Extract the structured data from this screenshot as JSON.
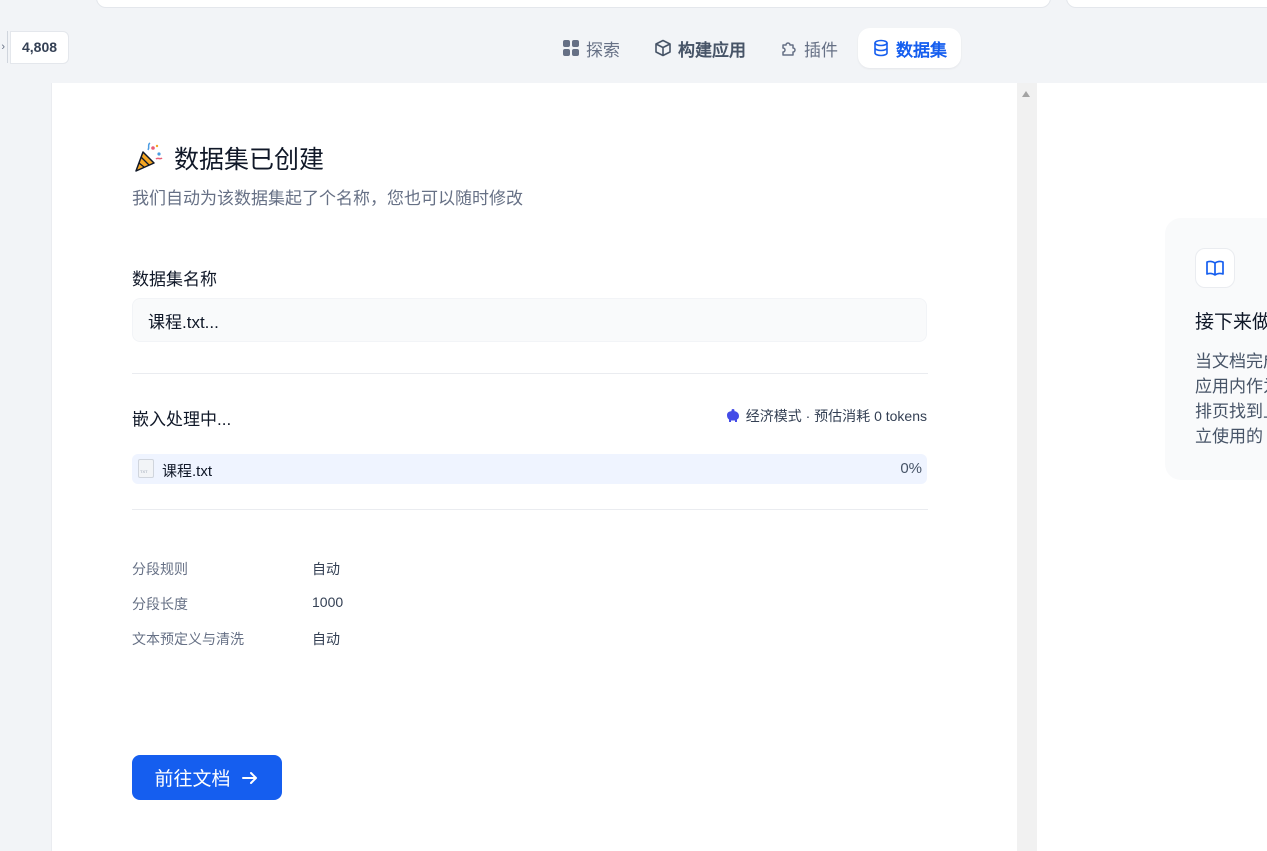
{
  "header": {
    "github_stars": "4,808",
    "nav": [
      {
        "label": "探索",
        "icon": "grid-icon"
      },
      {
        "label": "构建应用",
        "icon": "cube-icon"
      },
      {
        "label": "插件",
        "icon": "puzzle-icon"
      },
      {
        "label": "数据集",
        "icon": "database-icon",
        "active": true
      }
    ]
  },
  "main": {
    "title": "数据集已创建",
    "subtitle": "我们自动为该数据集起了个名称，您也可以随时修改",
    "name_label": "数据集名称",
    "name_value": "课程.txt...",
    "embedding": {
      "label": "嵌入处理中...",
      "mode": "经济模式 · 预估消耗 0 tokens"
    },
    "file": {
      "name": "课程.txt",
      "progress": "0%"
    },
    "rules": [
      {
        "key": "分段规则",
        "value": "自动"
      },
      {
        "key": "分段长度",
        "value": "1000"
      },
      {
        "key": "文本预定义与清洗",
        "value": "自动"
      }
    ],
    "go_button": "前往文档"
  },
  "tip": {
    "title": "接下来做什么",
    "body": [
      "当文档完成索引处理后，",
      "应用内作为上下文使用，",
      "排页找到上下文设置，",
      "立使用的"
    ]
  },
  "colors": {
    "accent": "#155eef",
    "background": "#f2f4f7",
    "file_row": "#eff4ff"
  }
}
